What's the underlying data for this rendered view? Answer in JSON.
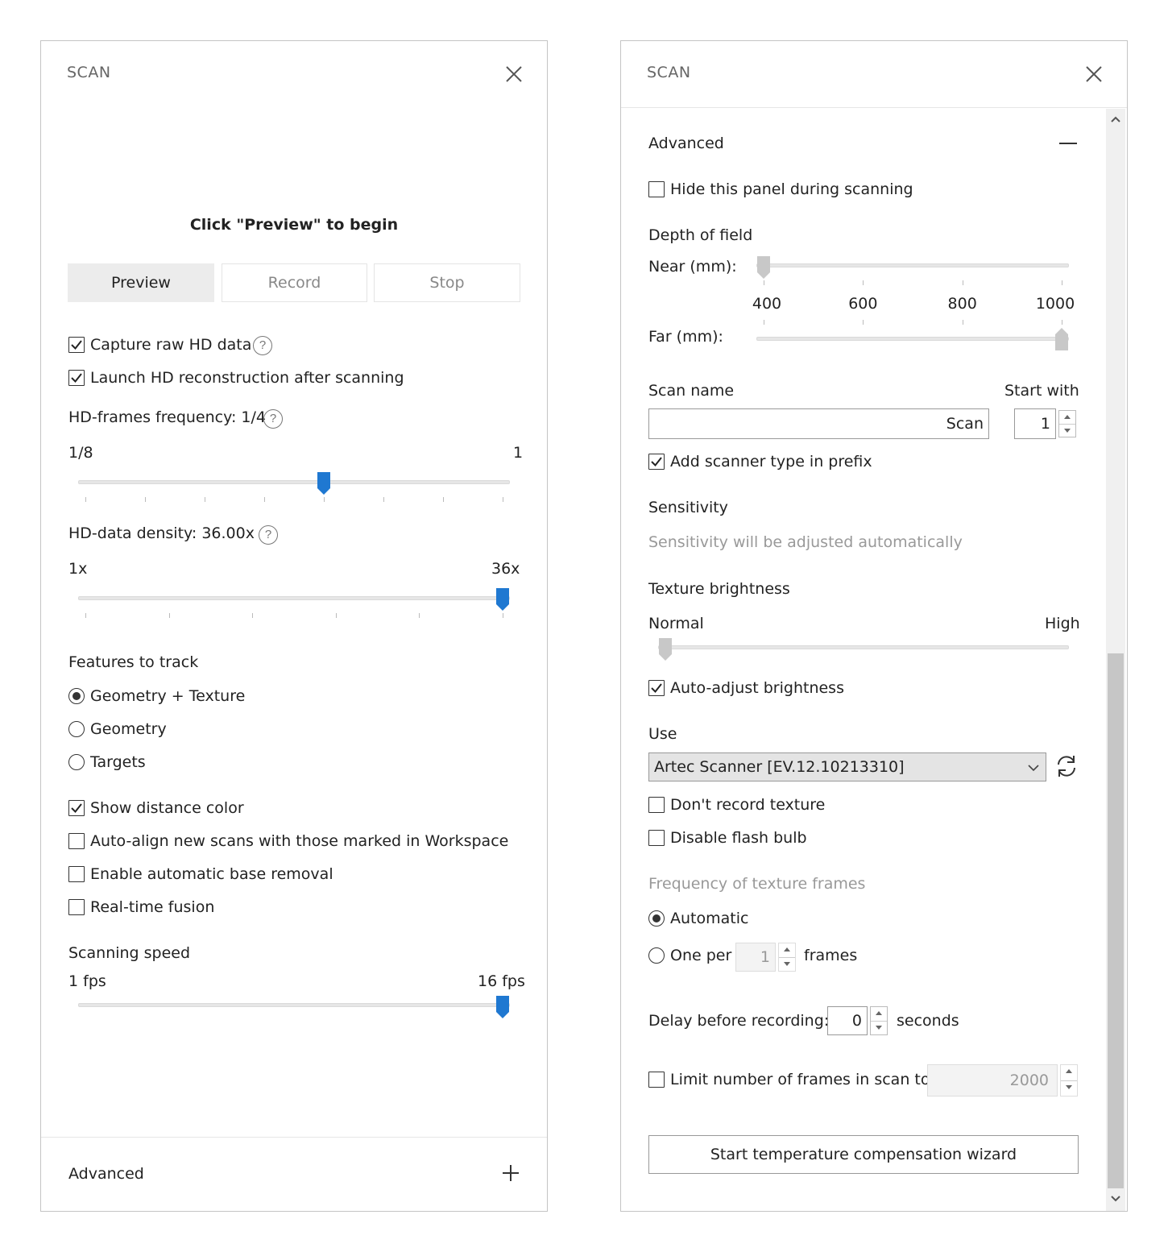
{
  "left": {
    "title": "SCAN",
    "hint": "Click \"Preview\" to begin",
    "buttons": {
      "preview": "Preview",
      "record": "Record",
      "stop": "Stop"
    },
    "capture_raw": {
      "label": "Capture raw HD data",
      "checked": true
    },
    "launch_hd": {
      "label": "Launch HD reconstruction after scanning",
      "checked": true
    },
    "hd_freq": {
      "label": "HD-frames frequency: 1/4",
      "min": "1/8",
      "max": "1",
      "value": 0.571
    },
    "hd_density": {
      "label": "HD-data density: 36.00x",
      "min": "1x",
      "max": "36x",
      "value": 1.0
    },
    "features": {
      "label": "Features to track",
      "options": [
        "Geometry + Texture",
        "Geometry",
        "Targets"
      ],
      "selected": 0
    },
    "show_distance": {
      "label": "Show distance color",
      "checked": true
    },
    "auto_align": {
      "label": "Auto-align new scans with those marked in Workspace",
      "checked": false
    },
    "base_removal": {
      "label": "Enable automatic base removal",
      "checked": false
    },
    "realtime_fusion": {
      "label": "Real-time fusion",
      "checked": false
    },
    "scan_speed": {
      "label": "Scanning speed",
      "min": "1 fps",
      "max": "16 fps",
      "value": 1.0
    },
    "advanced": "Advanced"
  },
  "right": {
    "title": "SCAN",
    "advanced": "Advanced",
    "hide_panel": {
      "label": "Hide this panel during scanning",
      "checked": false
    },
    "dof": {
      "label": "Depth of field",
      "near_label": "Near (mm):",
      "far_label": "Far (mm):",
      "ticks": [
        "400",
        "600",
        "800",
        "1000"
      ],
      "near_value": 0.0,
      "far_value": 1.0
    },
    "scan_name": {
      "label": "Scan name",
      "value": "Scan"
    },
    "start_with": {
      "label": "Start with",
      "value": "1"
    },
    "scanner_prefix": {
      "label": "Add scanner type in prefix",
      "checked": true
    },
    "sensitivity": {
      "label": "Sensitivity",
      "note": "Sensitivity will be adjusted automatically"
    },
    "texture": {
      "label": "Texture brightness",
      "min": "Normal",
      "max": "High",
      "value": 0.0
    },
    "auto_brightness": {
      "label": "Auto-adjust brightness",
      "checked": true
    },
    "use": {
      "label": "Use",
      "value": "Artec Scanner [EV.12.10213310]"
    },
    "no_texture": {
      "label": "Don't record texture",
      "checked": false
    },
    "no_flash": {
      "label": "Disable flash bulb",
      "checked": false
    },
    "tex_freq": {
      "label": "Frequency of texture frames",
      "automatic": "Automatic",
      "one_per": "One per",
      "one_per_value": "1",
      "frames": "frames"
    },
    "delay": {
      "label": "Delay before recording:",
      "value": "0",
      "unit": "seconds"
    },
    "limit": {
      "label": "Limit number of frames in scan to",
      "value": "2000",
      "checked": false
    },
    "wizard": "Start temperature compensation wizard"
  },
  "icons": {
    "close": "close-icon",
    "help": "help-icon",
    "refresh": "refresh-icon",
    "plus": "plus-icon",
    "minus": "minus-icon",
    "dropdown": "chevron-down-icon"
  },
  "colors": {
    "accent": "#1f78d1",
    "thumb_gray": "#c8c8c8"
  }
}
